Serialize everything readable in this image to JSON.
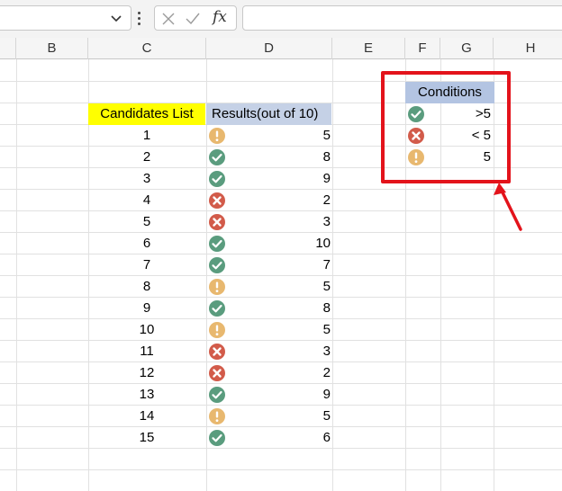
{
  "formula_bar": {
    "name_box_value": "",
    "formula_value": "",
    "insert_function_label": "fx"
  },
  "columns": [
    "B",
    "C",
    "D",
    "E",
    "F",
    "G",
    "H"
  ],
  "table": {
    "header_c": "Candidates List",
    "header_d": "Results(out of 10)",
    "rows": [
      {
        "candidate": "1",
        "icon": "exclamation-icon",
        "result": "5"
      },
      {
        "candidate": "2",
        "icon": "check-icon",
        "result": "8"
      },
      {
        "candidate": "3",
        "icon": "check-icon",
        "result": "9"
      },
      {
        "candidate": "4",
        "icon": "cross-icon",
        "result": "2"
      },
      {
        "candidate": "5",
        "icon": "cross-icon",
        "result": "3"
      },
      {
        "candidate": "6",
        "icon": "check-icon",
        "result": "10"
      },
      {
        "candidate": "7",
        "icon": "check-icon",
        "result": "7"
      },
      {
        "candidate": "8",
        "icon": "exclamation-icon",
        "result": "5"
      },
      {
        "candidate": "9",
        "icon": "check-icon",
        "result": "8"
      },
      {
        "candidate": "10",
        "icon": "exclamation-icon",
        "result": "5"
      },
      {
        "candidate": "11",
        "icon": "cross-icon",
        "result": "3"
      },
      {
        "candidate": "12",
        "icon": "cross-icon",
        "result": "2"
      },
      {
        "candidate": "13",
        "icon": "check-icon",
        "result": "9"
      },
      {
        "candidate": "14",
        "icon": "exclamation-icon",
        "result": "5"
      },
      {
        "candidate": "15",
        "icon": "check-icon",
        "result": "6"
      }
    ]
  },
  "conditions": {
    "header": "Conditions",
    "items": [
      {
        "icon": "check-icon",
        "rule": ">5"
      },
      {
        "icon": "cross-icon",
        "rule": "< 5"
      },
      {
        "icon": "exclamation-icon",
        "rule": "5"
      }
    ]
  },
  "colors": {
    "check": "#5a9c7e",
    "cross": "#d25b4a",
    "exclamation": "#e8b86f",
    "highlight_box": "#e3131b",
    "header_yellow": "#ffff00",
    "header_blue": "#c5d1e6"
  }
}
